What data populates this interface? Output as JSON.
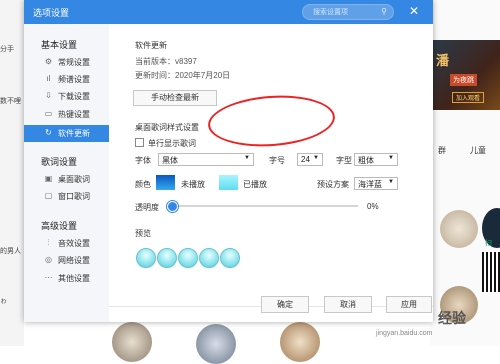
{
  "background": {
    "left_texts": [
      "分手",
      "数不哩",
      "的男人",
      "ゎ"
    ],
    "banner": {
      "title": "潘",
      "line1": "为夜跳",
      "line2": "加入观看"
    },
    "tabs": [
      "群",
      "儿童"
    ],
    "qr_label": "扫"
  },
  "dialog": {
    "title": "选项设置",
    "search_placeholder": "搜索设置项",
    "close": "✕",
    "sidebar": {
      "groups": [
        {
          "label": "基本设置",
          "items": [
            {
              "icon": "gear-icon",
              "glyph": "⚙",
              "label": "常规设置"
            },
            {
              "icon": "bars-icon",
              "glyph": "ıl",
              "label": "频谱设置"
            },
            {
              "icon": "download-icon",
              "glyph": "⇩",
              "label": "下载设置"
            },
            {
              "icon": "keyboard-icon",
              "glyph": "▭",
              "label": "热键设置"
            },
            {
              "icon": "refresh-icon",
              "glyph": "↻",
              "label": "软件更新"
            }
          ]
        },
        {
          "label": "歌词设置",
          "items": [
            {
              "icon": "desktop-lyrics-icon",
              "glyph": "▣",
              "label": "桌面歌词"
            },
            {
              "icon": "window-lyrics-icon",
              "glyph": "▢",
              "label": "窗口歌词"
            }
          ]
        },
        {
          "label": "高级设置",
          "items": [
            {
              "icon": "equalizer-icon",
              "glyph": "⫶",
              "label": "音效设置"
            },
            {
              "icon": "network-icon",
              "glyph": "◎",
              "label": "网络设置"
            },
            {
              "icon": "more-icon",
              "glyph": "⋯",
              "label": "其他设置"
            }
          ]
        }
      ]
    },
    "update": {
      "heading": "软件更新",
      "version": "当前版本：v8397",
      "date": "更新时间：2020年7月20日",
      "check_button": "手动检查最新"
    },
    "lyrics": {
      "heading": "桌面歌词样式设置",
      "single_line": "单行显示歌词",
      "font_label": "字体",
      "font_value": "黑体",
      "size_label": "字号",
      "size_value": "24",
      "style_label": "字型",
      "style_value": "粗体",
      "color_label": "颜色",
      "unplayed": "未播放",
      "played": "已播放",
      "preset_label": "预设方案",
      "preset_value": "海洋蓝",
      "opacity_label": "透明度",
      "opacity_value": "0%",
      "preview_label": "预览"
    },
    "footer": {
      "ok": "确定",
      "cancel": "取消",
      "apply": "应用"
    }
  },
  "watermark": {
    "cn": "经验",
    "url": "jingyan.baidu.com"
  },
  "colors": {
    "accent": "#3487e2",
    "annotation": "#ee2222"
  }
}
